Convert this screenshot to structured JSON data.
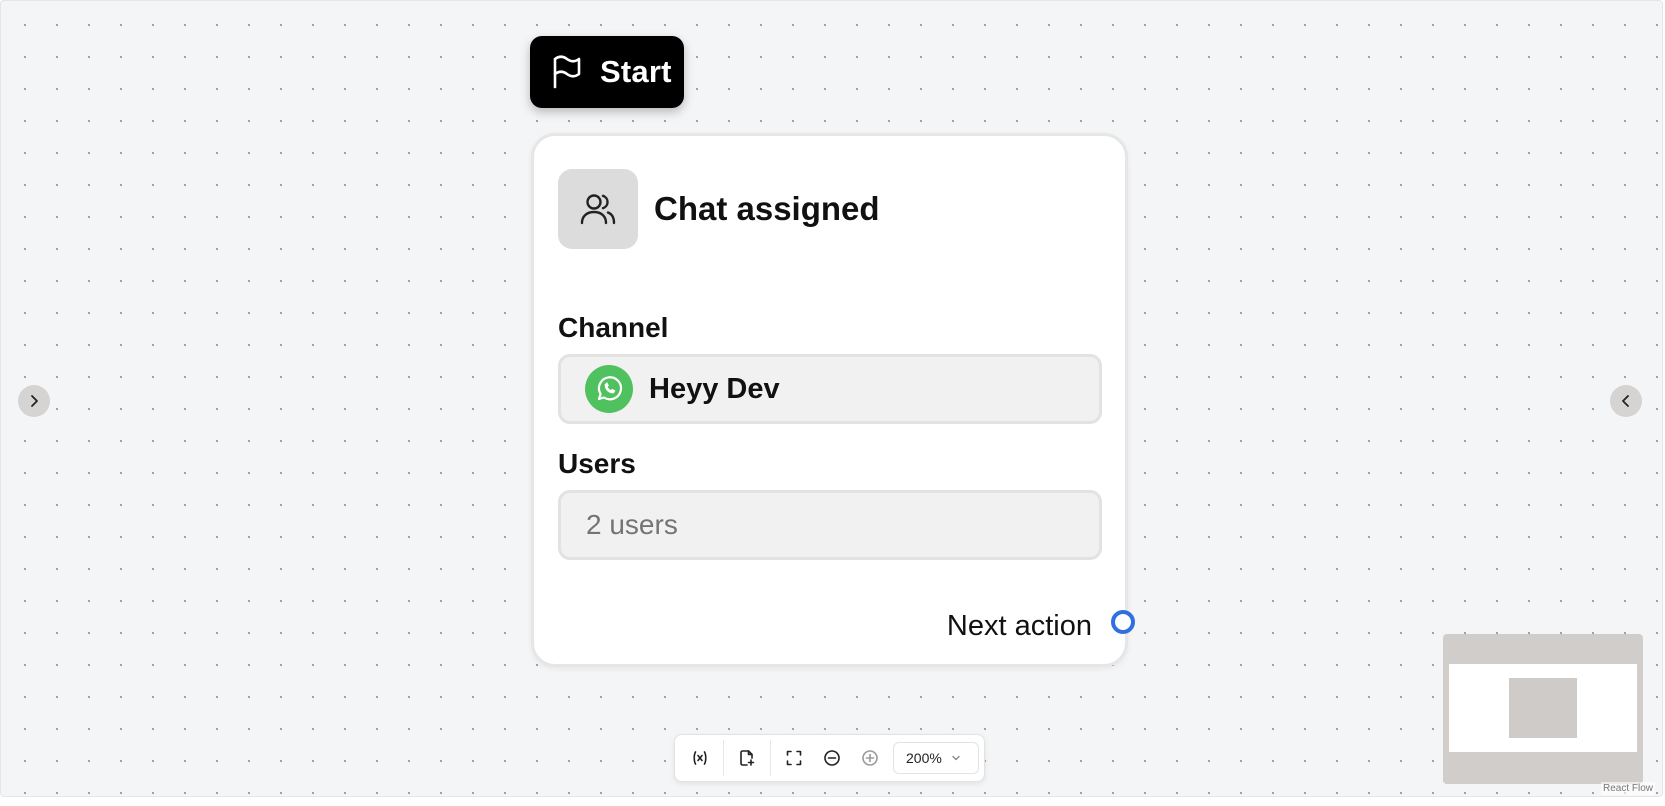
{
  "start_node": {
    "label": "Start",
    "icon": "flag-icon"
  },
  "trigger_card": {
    "title": "Chat assigned",
    "icon": "users-icon",
    "channel": {
      "label": "Channel",
      "value": "Heyy Dev",
      "icon": "whatsapp-icon",
      "icon_color": "#4fc15e"
    },
    "users": {
      "label": "Users",
      "value": "2 users"
    },
    "next_action_label": "Next action",
    "handle_color": "#2f6fdf"
  },
  "toolbar": {
    "buttons": [
      "variable-icon",
      "add-file-icon",
      "fit-view-icon",
      "zoom-out-icon",
      "zoom-in-icon"
    ],
    "zoom_level": "200%"
  },
  "attribution": "React Flow"
}
